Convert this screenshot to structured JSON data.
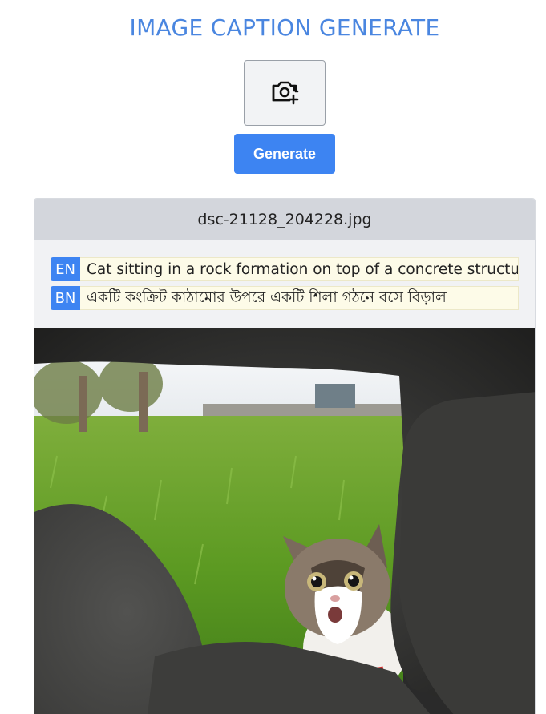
{
  "app": {
    "title": "IMAGE CAPTION GENERATE"
  },
  "upload": {
    "icon": "camera-plus-icon"
  },
  "actions": {
    "generate_label": "Generate"
  },
  "result": {
    "filename": "dsc-21128_204228.jpg",
    "captions": [
      {
        "lang": "EN",
        "text": "Cat sitting in a rock formation on top of a concrete structure"
      },
      {
        "lang": "BN",
        "text": "একটি কংক্রিট কাঠামোর উপরে একটি শিলা গঠনে বসে বিড়াল"
      }
    ]
  },
  "colors": {
    "accent": "#3d84f2",
    "title": "#4a86e0",
    "caption_bg": "#fdfbe8"
  }
}
